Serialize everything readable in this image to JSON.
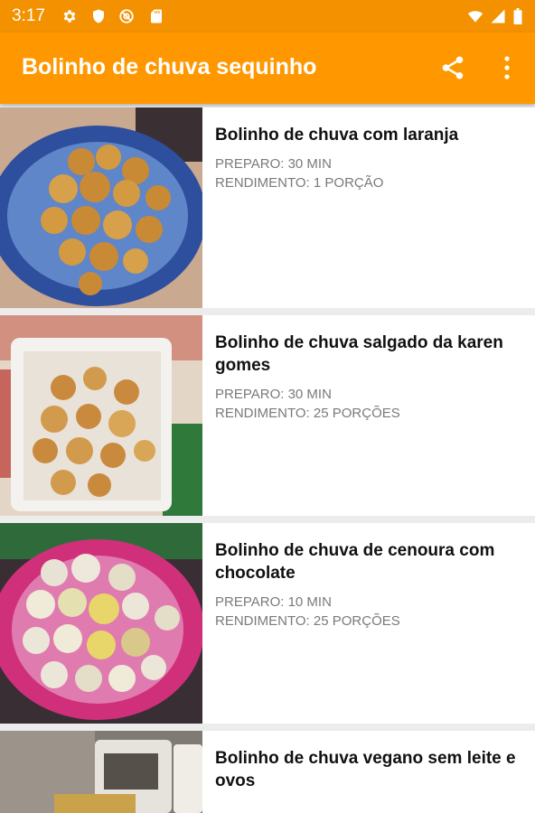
{
  "status_bar": {
    "time": "3:17",
    "left_icons": [
      "settings-icon",
      "shield-icon",
      "at-sign-icon",
      "sd-card-icon"
    ],
    "right_icons": [
      "wifi-icon",
      "signal-icon",
      "battery-icon"
    ]
  },
  "app_bar": {
    "title": "Bolinho de chuva sequinho",
    "actions": [
      "share-icon",
      "more-vert-icon"
    ],
    "color": "#ff9800"
  },
  "recipes": [
    {
      "title": "Bolinho de chuva com laranja",
      "preparo": "PREPARO: 30 MIN",
      "rendimento": "RENDIMENTO: 1 PORÇÃO"
    },
    {
      "title": "Bolinho de chuva salgado da karen gomes",
      "preparo": "PREPARO: 30 MIN",
      "rendimento": "RENDIMENTO: 25 PORÇÕES"
    },
    {
      "title": "Bolinho de chuva de cenoura com chocolate",
      "preparo": "PREPARO: 10 MIN",
      "rendimento": "RENDIMENTO: 25 PORÇÕES"
    },
    {
      "title": "Bolinho de chuva vegano sem leite e ovos"
    }
  ]
}
